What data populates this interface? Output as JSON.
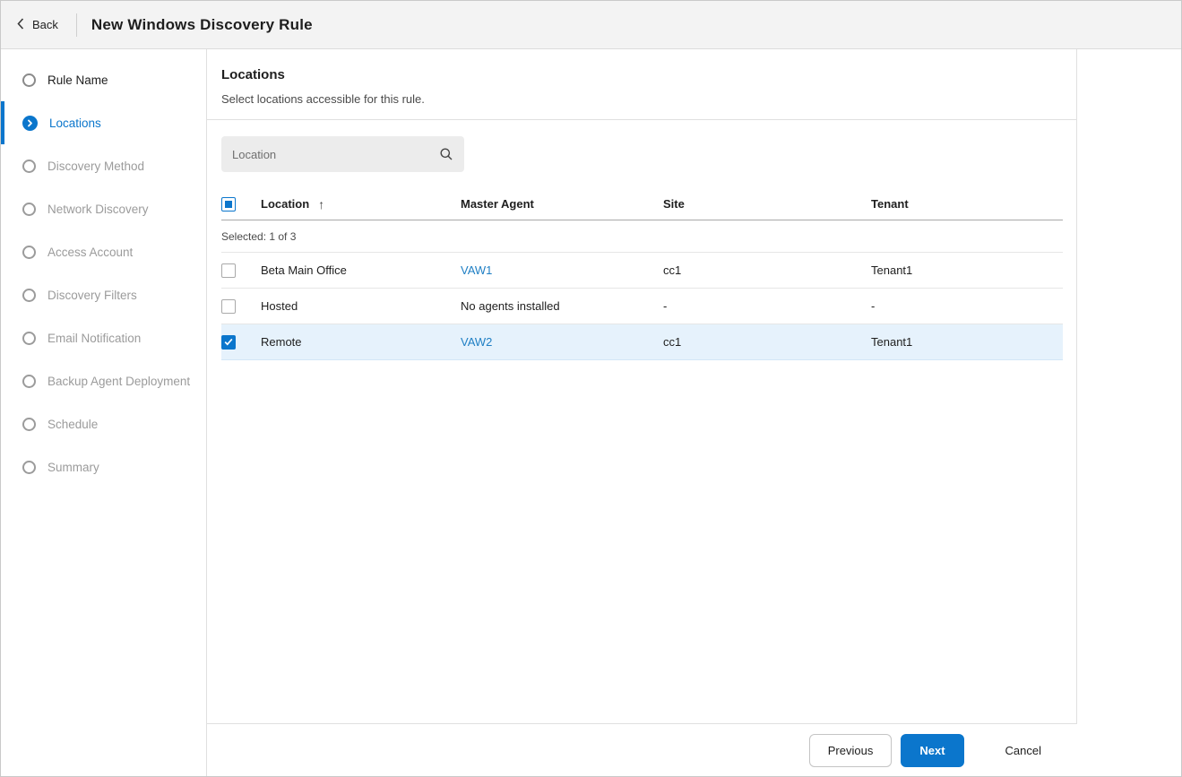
{
  "colors": {
    "accent": "#0b76cc",
    "link": "#1f7fc4",
    "selected_row": "#e6f2fc"
  },
  "header": {
    "back_label": "Back",
    "title": "New Windows Discovery Rule"
  },
  "sidebar": {
    "steps": [
      {
        "label": "Rule Name",
        "state": "done"
      },
      {
        "label": "Locations",
        "state": "active"
      },
      {
        "label": "Discovery Method",
        "state": "pending"
      },
      {
        "label": "Network Discovery",
        "state": "pending"
      },
      {
        "label": "Access Account",
        "state": "pending"
      },
      {
        "label": "Discovery Filters",
        "state": "pending"
      },
      {
        "label": "Email Notification",
        "state": "pending"
      },
      {
        "label": "Backup Agent Deployment",
        "state": "pending"
      },
      {
        "label": "Schedule",
        "state": "pending"
      },
      {
        "label": "Summary",
        "state": "pending"
      }
    ]
  },
  "main": {
    "title": "Locations",
    "subtitle": "Select locations accessible for this rule.",
    "search": {
      "placeholder": "Location",
      "icon": "magnifier"
    },
    "table": {
      "columns": [
        "Location",
        "Master Agent",
        "Site",
        "Tenant"
      ],
      "sort_icon": "↑",
      "sort_column": "Location",
      "select_all_state": "indeterminate",
      "selected_summary": "Selected: 1 of 3",
      "rows": [
        {
          "checked": false,
          "location": "Beta Main Office",
          "master_agent": "VAW1",
          "master_agent_is_link": true,
          "site": "cc1",
          "tenant": "Tenant1"
        },
        {
          "checked": false,
          "location": "Hosted",
          "master_agent": "No agents installed",
          "master_agent_is_link": false,
          "site": "-",
          "tenant": "-"
        },
        {
          "checked": true,
          "location": "Remote",
          "master_agent": "VAW2",
          "master_agent_is_link": true,
          "site": "cc1",
          "tenant": "Tenant1"
        }
      ]
    }
  },
  "footer": {
    "previous_label": "Previous",
    "next_label": "Next",
    "cancel_label": "Cancel"
  }
}
